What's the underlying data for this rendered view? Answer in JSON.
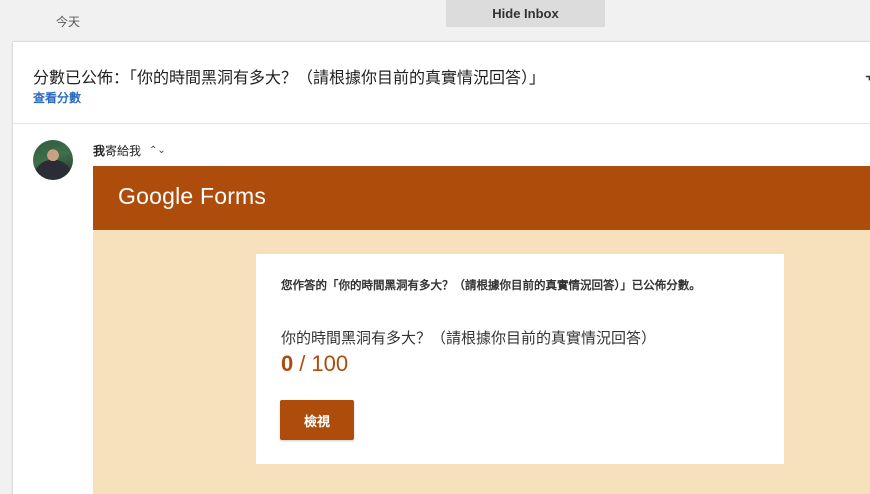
{
  "thread": {
    "day_label": "今天",
    "hide_inbox_label": "Hide Inbox"
  },
  "email": {
    "subject": "分數已公佈：「你的時間黑洞有多大？（請根據你目前的真實情況回答）」",
    "view_score_link": "查看分數",
    "edge_glyph": "ᆩ",
    "sender": "我",
    "recipient_text": "寄給我",
    "details_chevron": "⌃⌄"
  },
  "forms_card": {
    "logo_text": "Google Forms",
    "announcement": "您作答的「你的時間黑洞有多大？（請根據你目前的真實情況回答）」已公佈分數。",
    "quiz_title": "你的時間黑洞有多大？（請根據你目前的真實情況回答）",
    "score": "0",
    "separator": "/",
    "max_score": "100",
    "view_button_label": "檢視"
  },
  "colors": {
    "forms_accent": "#ae4c0c",
    "forms_background": "#f7e1bd",
    "link_blue": "#2a6bc4"
  }
}
